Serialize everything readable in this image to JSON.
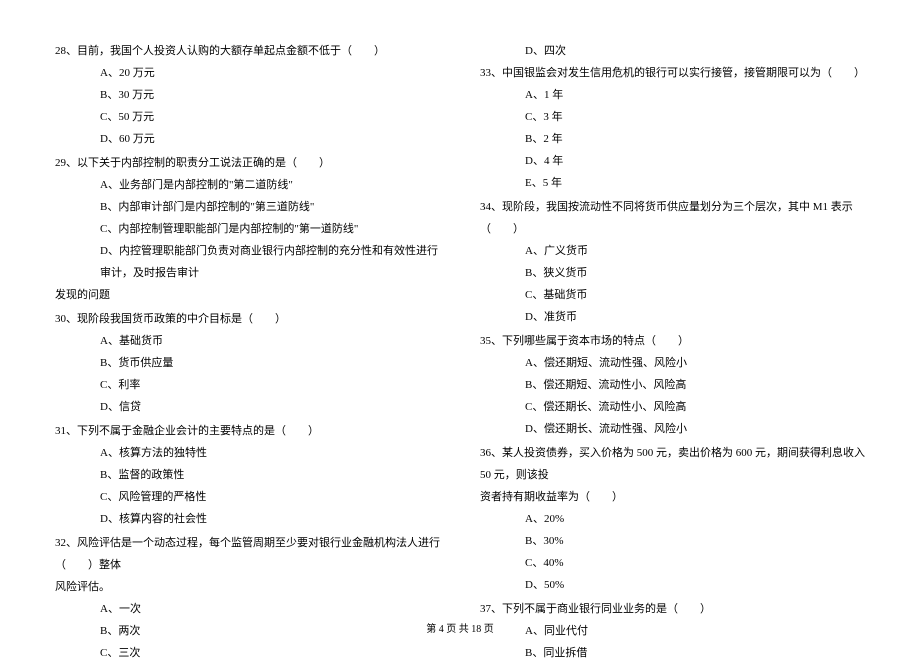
{
  "left": {
    "q28": {
      "text": "28、目前，我国个人投资人认购的大额存单起点金额不低于（　　）",
      "a": "A、20 万元",
      "b": "B、30 万元",
      "c": "C、50 万元",
      "d": "D、60 万元"
    },
    "q29": {
      "text": "29、以下关于内部控制的职责分工说法正确的是（　　）",
      "a": "A、业务部门是内部控制的\"第二道防线\"",
      "b": "B、内部审计部门是内部控制的\"第三道防线\"",
      "c": "C、内部控制管理职能部门是内部控制的\"第一道防线\"",
      "d": "D、内控管理职能部门负责对商业银行内部控制的充分性和有效性进行审计，及时报告审计",
      "d_cont": "发现的问题"
    },
    "q30": {
      "text": "30、现阶段我国货币政策的中介目标是（　　）",
      "a": "A、基础货币",
      "b": "B、货币供应量",
      "c": "C、利率",
      "d": "D、信贷"
    },
    "q31": {
      "text": "31、下列不属于金融企业会计的主要特点的是（　　）",
      "a": "A、核算方法的独特性",
      "b": "B、监督的政策性",
      "c": "C、风险管理的严格性",
      "d": "D、核算内容的社会性"
    },
    "q32": {
      "text": "32、风险评估是一个动态过程，每个监管周期至少要对银行业金融机构法人进行（　　）整体",
      "cont": "风险评估。",
      "a": "A、一次",
      "b": "B、两次",
      "c": "C、三次"
    }
  },
  "right": {
    "q32d": "D、四次",
    "q33": {
      "text": "33、中国银监会对发生信用危机的银行可以实行接管，接管期限可以为（　　）",
      "a": "A、1 年",
      "c": "C、3 年",
      "b": "B、2 年",
      "d": "D、4 年",
      "e": "E、5 年"
    },
    "q34": {
      "text": "34、现阶段，我国按流动性不同将货币供应量划分为三个层次，其中 M1 表示（　　）",
      "a": "A、广义货币",
      "b": "B、狭义货币",
      "c": "C、基础货币",
      "d": "D、准货币"
    },
    "q35": {
      "text": "35、下列哪些属于资本市场的特点（　　）",
      "a": "A、偿还期短、流动性强、风险小",
      "b": "B、偿还期短、流动性小、风险高",
      "c": "C、偿还期长、流动性小、风险高",
      "d": "D、偿还期长、流动性强、风险小"
    },
    "q36": {
      "text": "36、某人投资债券，买入价格为 500 元，卖出价格为 600 元，期间获得利息收入 50 元，则该投",
      "cont": "资者持有期收益率为（　　）",
      "a": "A、20%",
      "b": "B、30%",
      "c": "C、40%",
      "d": "D、50%"
    },
    "q37": {
      "text": "37、下列不属于商业银行同业业务的是（　　）",
      "a": "A、同业代付",
      "b": "B、同业拆借"
    }
  },
  "footer": "第 4 页 共 18 页"
}
